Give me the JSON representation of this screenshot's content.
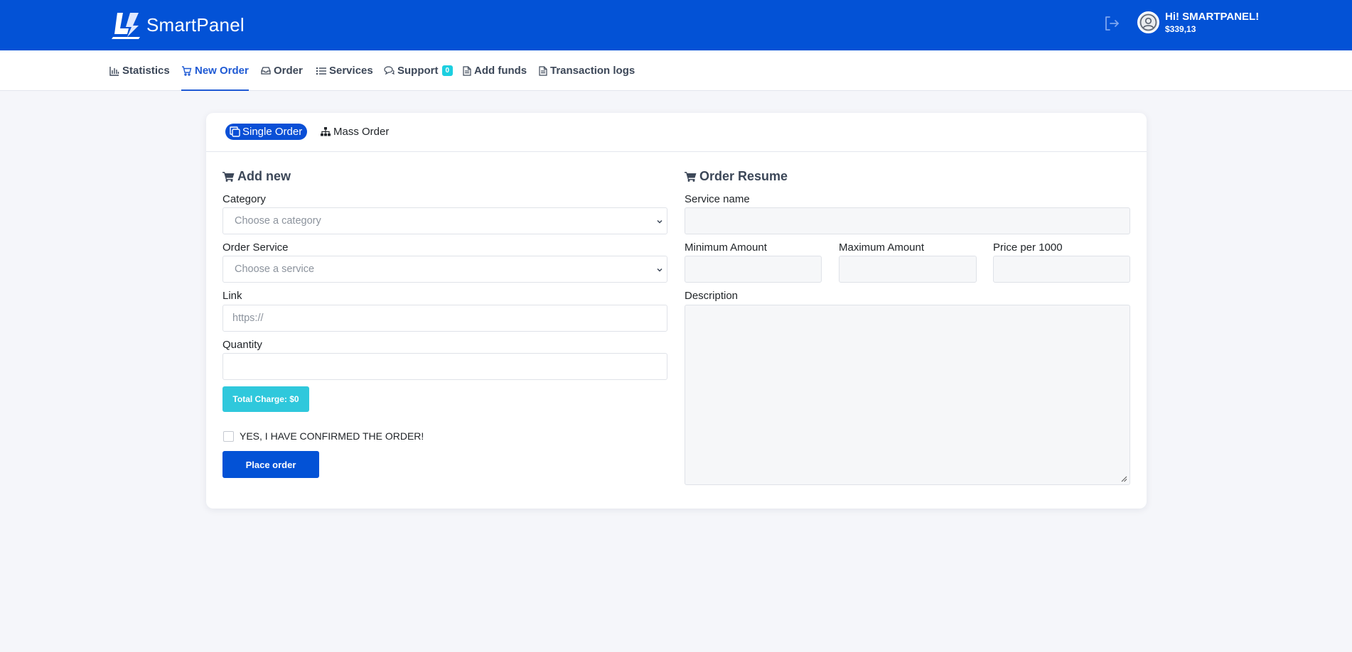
{
  "header": {
    "logo_text": "SmartPanel",
    "greeting": "Hi! SMARTPANEL!",
    "balance": "$339,13",
    "icons": [
      "logo-icon",
      "logout-icon",
      "user-avatar-icon"
    ]
  },
  "nav": {
    "items": [
      {
        "label": "Statistics",
        "icon": "bar-chart-icon"
      },
      {
        "label": "New Order",
        "icon": "cart-icon",
        "active": true
      },
      {
        "label": "Order",
        "icon": "inbox-icon"
      },
      {
        "label": "Services",
        "icon": "list-icon"
      },
      {
        "label": "Support",
        "icon": "chat-icon",
        "badge": "0"
      },
      {
        "label": "Add funds",
        "icon": "document-icon"
      },
      {
        "label": "Transaction logs",
        "icon": "document-icon"
      }
    ]
  },
  "tabs": {
    "single": "Single Order",
    "mass": "Mass Order"
  },
  "add_new": {
    "title": "Add new",
    "category_label": "Category",
    "category_value": "Choose a category",
    "service_label": "Order Service",
    "service_value": "Choose a service",
    "link_label": "Link",
    "link_placeholder": "https://",
    "quantity_label": "Quantity",
    "quantity_value": "",
    "total_charge": "Total Charge: $0",
    "confirm_label": "YES, I HAVE CONFIRMED THE ORDER!",
    "place_order": "Place order"
  },
  "resume": {
    "title": "Order Resume",
    "service_name_label": "Service name",
    "min_label": "Minimum Amount",
    "max_label": "Maximum Amount",
    "price_label": "Price per 1000",
    "description_label": "Description"
  },
  "colors": {
    "primary": "#0352d6",
    "accent_cyan": "#2fc8dc",
    "background": "#f5f6fa"
  }
}
